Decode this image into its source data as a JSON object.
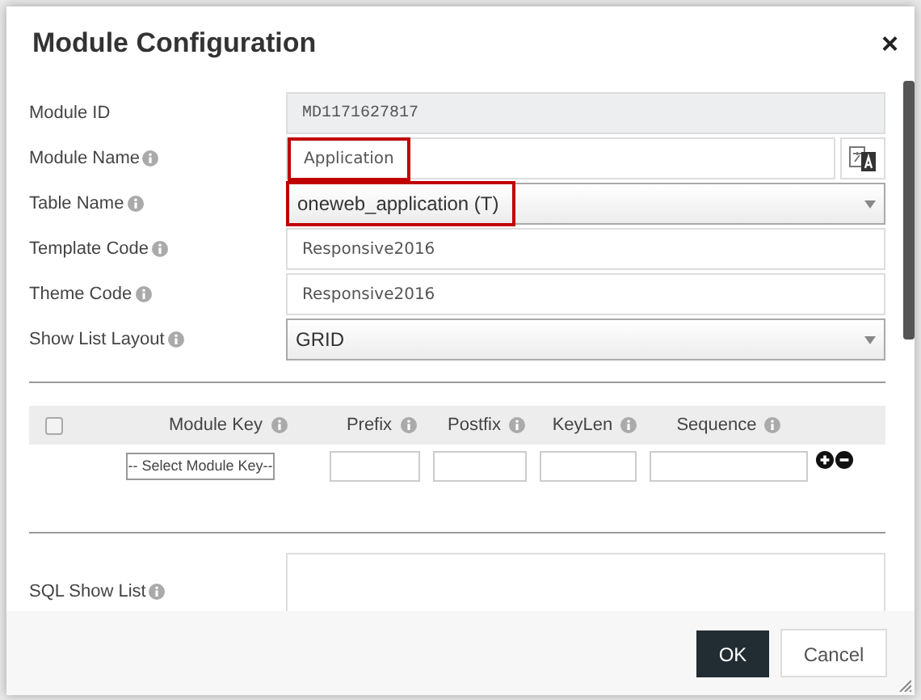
{
  "dialog": {
    "title": "Module Configuration",
    "close": "×"
  },
  "fields": [
    {
      "label": "Module ID",
      "info": false,
      "kind": "readonly",
      "value": "MD1171627817",
      "highlighted": false
    },
    {
      "label": "Module Name",
      "info": true,
      "kind": "text-translate",
      "value": "Application",
      "highlighted": true
    },
    {
      "label": "Table Name",
      "info": true,
      "kind": "select",
      "value": "oneweb_application (T)",
      "highlighted": true
    },
    {
      "label": "Template Code",
      "info": true,
      "kind": "text",
      "value": "Responsive2016",
      "highlighted": false
    },
    {
      "label": "Theme Code",
      "info": true,
      "kind": "text",
      "value": "Responsive2016",
      "highlighted": false
    },
    {
      "label": "Show List Layout",
      "info": true,
      "kind": "select",
      "value": "GRID",
      "highlighted": false
    }
  ],
  "module_keys": {
    "select_all_checked": false,
    "columns": [
      {
        "label": "Module Key"
      },
      {
        "label": "Prefix"
      },
      {
        "label": "Postfix"
      },
      {
        "label": "KeyLen"
      },
      {
        "label": "Sequence"
      }
    ],
    "rows": [
      {
        "module_key": "-- Select Module Key--"
      }
    ]
  },
  "sql_show_list": {
    "label": "SQL Show List",
    "info": true
  },
  "buttons": [
    {
      "label": "OK",
      "kind": "primary"
    },
    {
      "label": "Cancel",
      "kind": "secondary"
    }
  ]
}
